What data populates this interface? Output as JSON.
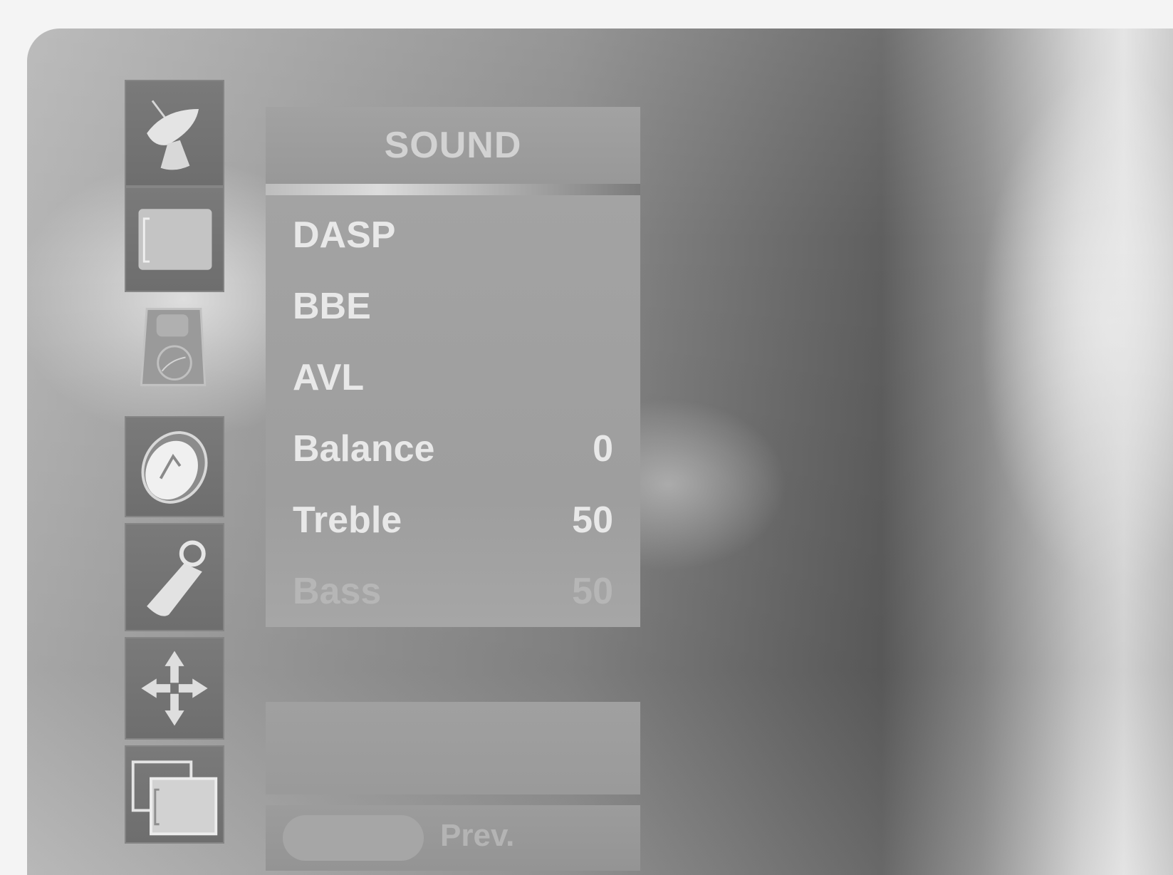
{
  "menu": {
    "title": "SOUND",
    "items": [
      {
        "label": "DASP",
        "value": ""
      },
      {
        "label": "BBE",
        "value": ""
      },
      {
        "label": "AVL",
        "value": ""
      },
      {
        "label": "Balance",
        "value": "0"
      },
      {
        "label": "Treble",
        "value": "50"
      },
      {
        "label": "Bass",
        "value": "50"
      }
    ]
  },
  "nav": {
    "prev_label": "Prev."
  },
  "sidebar": {
    "icons": [
      {
        "name": "satellite-dish-icon",
        "active": false
      },
      {
        "name": "picture-screen-icon",
        "active": false
      },
      {
        "name": "speaker-icon",
        "active": true
      },
      {
        "name": "clock-icon",
        "active": false
      },
      {
        "name": "key-tag-icon",
        "active": false
      },
      {
        "name": "move-arrows-icon",
        "active": false
      },
      {
        "name": "pip-screens-icon",
        "active": false
      }
    ]
  }
}
